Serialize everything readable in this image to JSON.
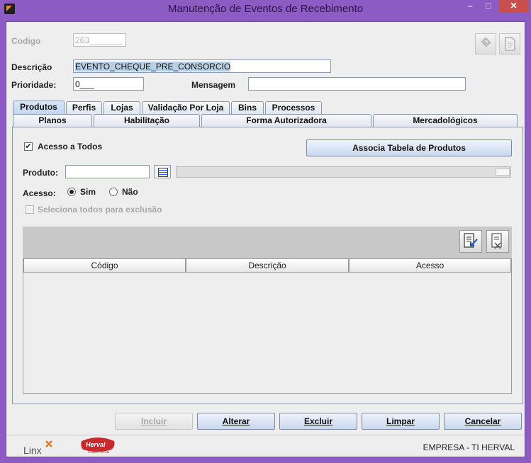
{
  "window": {
    "title": "Manutenção de Eventos de Recebimento",
    "controls": {
      "minimize": "–",
      "maximize": "□",
      "close": "✕"
    }
  },
  "form": {
    "codigo_label": "Codigo",
    "codigo_value": "263_______",
    "descricao_label": "Descrição",
    "descricao_value": "EVENTO_CHEQUE_PRE_CONSORCIO",
    "prioridade_label": "Prioridade:",
    "prioridade_value": "0___",
    "mensagem_label": "Mensagem",
    "mensagem_value": ""
  },
  "tabs_row1": [
    "Produtos",
    "Perfis",
    "Lojas",
    "Validação Por Loja",
    "Bins",
    "Processos"
  ],
  "tabs_row2": [
    "Planos",
    "Habilitação",
    "Forma Autorizadora",
    "Mercadológicos"
  ],
  "active_tab": "Produtos",
  "produtos": {
    "acesso_todos_label": "Acesso a Todos",
    "acesso_todos_checked": true,
    "associa_button": "Associa Tabela de Produtos",
    "produto_label": "Produto:",
    "produto_value": "",
    "acesso_label": "Acesso:",
    "radio_sim": "Sim",
    "radio_nao": "Não",
    "acesso_selected": "Sim",
    "seleciona_label": "Seleciona todos para exclusão",
    "seleciona_checked": false,
    "table_headers": [
      "Código",
      "Descrição",
      "Acesso"
    ],
    "rows": []
  },
  "actions": {
    "incluir": "Incluir",
    "alterar": "Alterar",
    "excluir": "Excluir",
    "limpar": "Limpar",
    "cancelar": "Cancelar"
  },
  "footer": {
    "logo_linx": "Linx",
    "logo_herval": "Herval",
    "logo_herval_sub": "Grupo Herval",
    "empresa_text": "EMPRESA   -   TI HERVAL"
  },
  "colors": {
    "title_bar": "#8c5cc4",
    "close_button": "#c74f4f",
    "panel": "#eeeeee",
    "grid_toolbar": "#c8c8c8",
    "button_gradient_bottom": "#c9d8ee"
  }
}
